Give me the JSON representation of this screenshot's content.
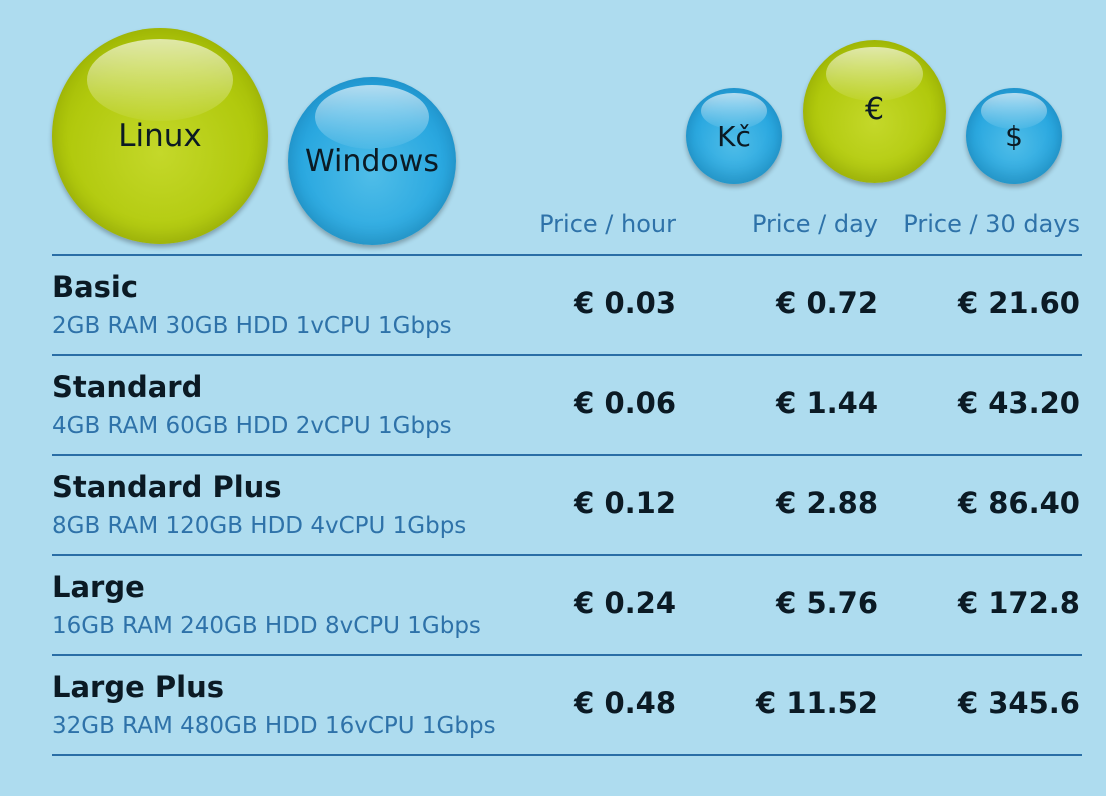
{
  "os_options": [
    {
      "label": "Linux",
      "selected": true
    },
    {
      "label": "Windows",
      "selected": false
    }
  ],
  "currency_options": [
    {
      "label": "Kč",
      "selected": false
    },
    {
      "label": "€",
      "selected": true
    },
    {
      "label": "$",
      "selected": false
    }
  ],
  "columns": {
    "hour": "Price / hour",
    "day": "Price / day",
    "month": "Price / 30 days"
  },
  "colors": {
    "background": "#aedcef",
    "selected_bubble": "#b1c90d",
    "unselected_bubble": "#2aa8e0",
    "accent_text": "#2e72a9",
    "rule": "#2a6ea6"
  },
  "plans": [
    {
      "name": "Basic",
      "specs": "2GB RAM 30GB HDD 1vCPU 1Gbps",
      "hour": "€ 0.03",
      "day": "€ 0.72",
      "month": "€ 21.60"
    },
    {
      "name": "Standard",
      "specs": "4GB RAM 60GB HDD 2vCPU 1Gbps",
      "hour": "€ 0.06",
      "day": "€ 1.44",
      "month": "€ 43.20"
    },
    {
      "name": "Standard Plus",
      "specs": "8GB RAM 120GB HDD 4vCPU 1Gbps",
      "hour": "€ 0.12",
      "day": "€ 2.88",
      "month": "€ 86.40"
    },
    {
      "name": "Large",
      "specs": "16GB RAM 240GB HDD 8vCPU 1Gbps",
      "hour": "€ 0.24",
      "day": "€ 5.76",
      "month": "€ 172.8"
    },
    {
      "name": "Large Plus",
      "specs": "32GB RAM 480GB HDD 16vCPU 1Gbps",
      "hour": "€ 0.48",
      "day": "€ 11.52",
      "month": "€ 345.6"
    }
  ]
}
